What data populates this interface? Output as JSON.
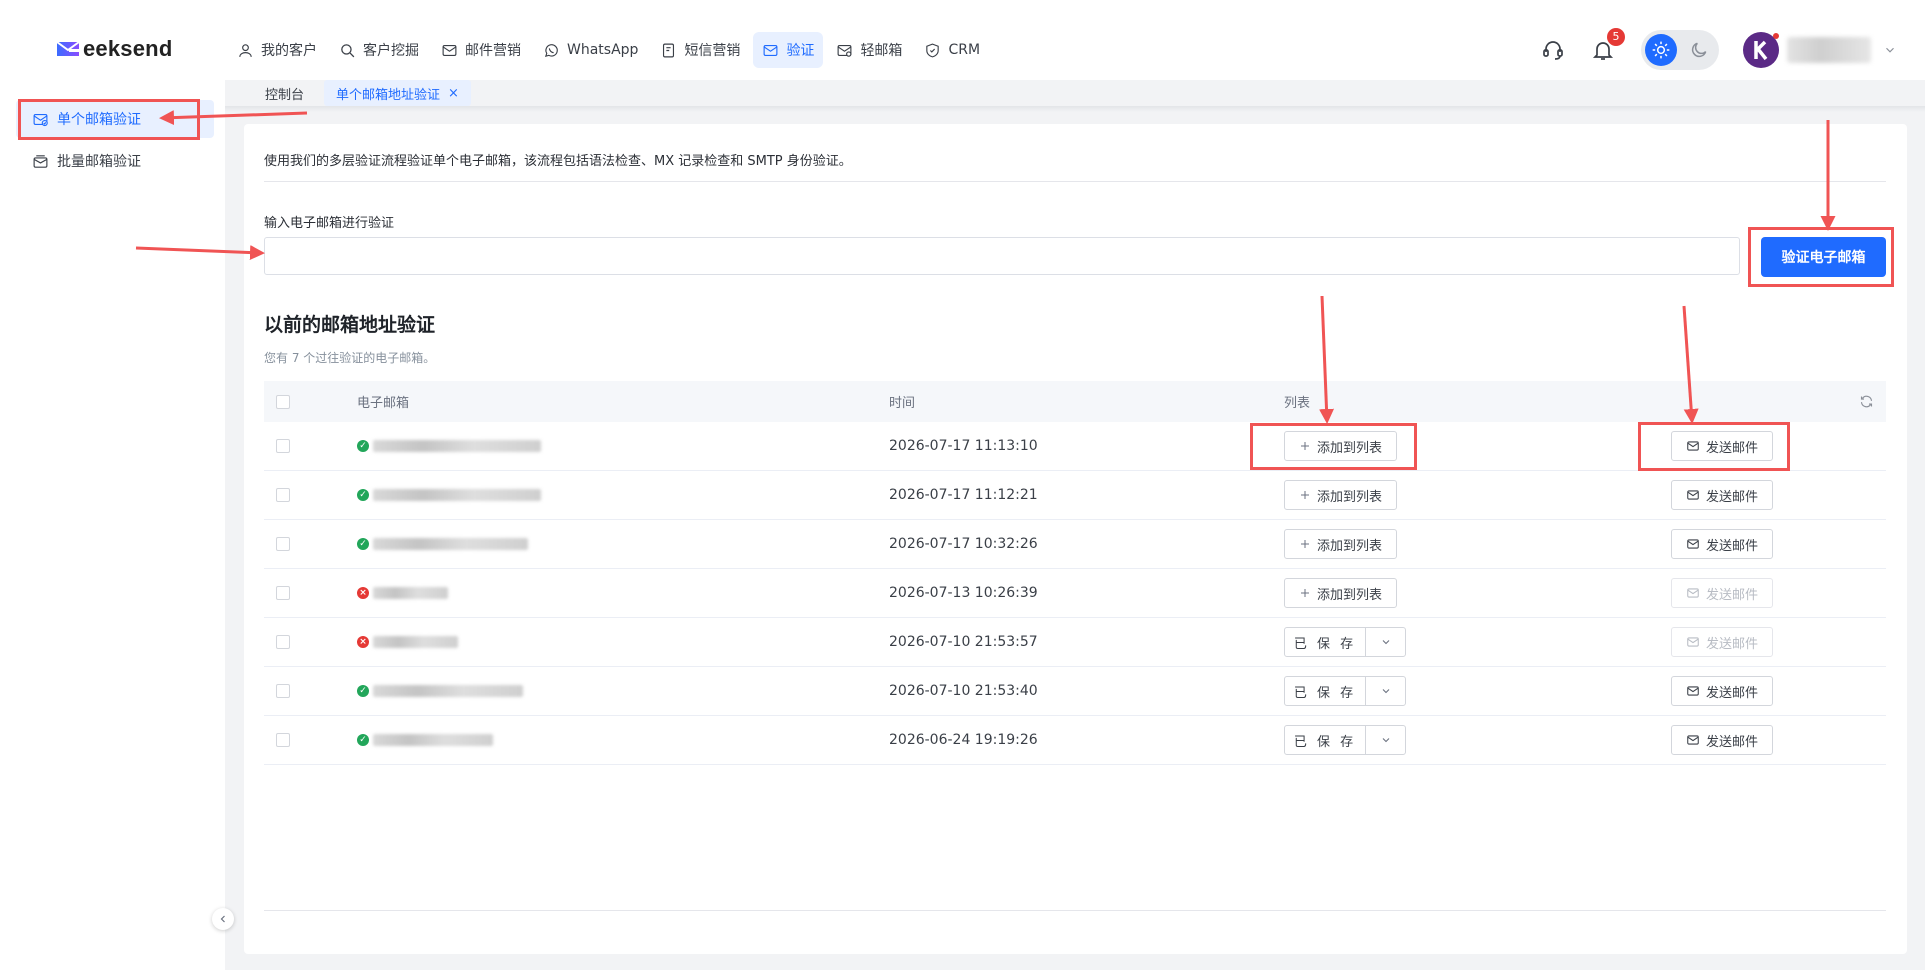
{
  "brand": {
    "logo_text": "eeksend"
  },
  "nav": [
    {
      "label": "我的客户",
      "icon": "user-icon"
    },
    {
      "label": "客户挖掘",
      "icon": "search-icon"
    },
    {
      "label": "邮件营销",
      "icon": "mail-icon"
    },
    {
      "label": "WhatsApp",
      "icon": "whatsapp-icon"
    },
    {
      "label": "短信营销",
      "icon": "sms-icon"
    },
    {
      "label": "验证",
      "icon": "mail-check-icon",
      "active": true
    },
    {
      "label": "轻邮箱",
      "icon": "mail-light-icon"
    },
    {
      "label": "CRM",
      "icon": "shield-icon"
    }
  ],
  "header": {
    "notification_count": "5"
  },
  "tabs": [
    {
      "label": "控制台"
    },
    {
      "label": "单个邮箱地址验证",
      "active": true,
      "close": "×"
    }
  ],
  "sidebar": {
    "items": [
      {
        "label": "单个邮箱验证",
        "active": true
      },
      {
        "label": "批量邮箱验证"
      }
    ]
  },
  "main": {
    "description": "使用我们的多层验证流程验证单个电子邮箱，该流程包括语法检查、MX 记录检查和 SMTP 身份验证。",
    "input_label": "输入电子邮箱进行验证",
    "input_value": "",
    "verify_button": "验证电子邮箱",
    "section_title": "以前的邮箱地址验证",
    "section_sub": "您有 7 个过往验证的电子邮箱。"
  },
  "table": {
    "headers": {
      "email": "电子邮箱",
      "time": "时间",
      "list": "列表"
    },
    "rows": [
      {
        "status": "valid",
        "time": "2026-07-17 11:13:10",
        "list_action": "添加到列表",
        "send_label": "发送邮件",
        "send_enabled": true
      },
      {
        "status": "valid",
        "time": "2026-07-17 11:12:21",
        "list_action": "添加到列表",
        "send_label": "发送邮件",
        "send_enabled": true
      },
      {
        "status": "valid",
        "time": "2026-07-17 10:32:26",
        "list_action": "添加到列表",
        "send_label": "发送邮件",
        "send_enabled": true
      },
      {
        "status": "invalid",
        "time": "2026-07-13 10:26:39",
        "list_action": "添加到列表",
        "send_label": "发送邮件",
        "send_enabled": false
      },
      {
        "status": "invalid",
        "time": "2026-07-10 21:53:57",
        "list_action": "已 保 存",
        "send_label": "发送邮件",
        "send_enabled": false
      },
      {
        "status": "valid",
        "time": "2026-07-10 21:53:40",
        "list_action": "已 保 存",
        "send_label": "发送邮件",
        "send_enabled": true
      },
      {
        "status": "valid",
        "time": "2026-06-24 19:19:26",
        "list_action": "已 保 存",
        "send_label": "发送邮件",
        "send_enabled": true
      }
    ]
  },
  "colors": {
    "accent": "#1f6bff",
    "annotation": "#f05454",
    "valid": "#22a65a",
    "invalid": "#e53935"
  }
}
